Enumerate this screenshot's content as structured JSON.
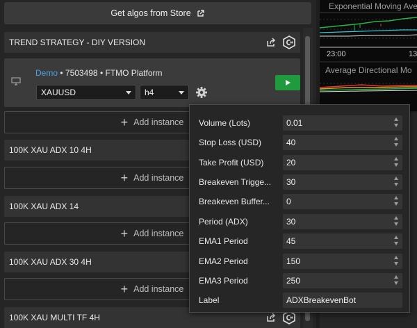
{
  "store_button": {
    "label": "Get algos from Store"
  },
  "strategies": [
    {
      "name": "TREND STRATEGY - DIY VERSION"
    },
    {
      "name": "100K XAU ADX 10 4H"
    },
    {
      "name": "100K XAU ADX 14"
    },
    {
      "name": "100K XAU ADX 30 4H"
    },
    {
      "name": "100K XAU MULTI TF 4H"
    }
  ],
  "instance": {
    "account_type": "Demo",
    "bullet1": " • ",
    "account_number": "7503498",
    "bullet2": " •  ",
    "platform": "FTMO Platform",
    "symbol": "XAUUSD",
    "timeframe": "h4"
  },
  "add_instance_label": "Add instance",
  "chart": {
    "indicator1": "Exponential Moving Ave",
    "indicator2": "Average Directional Mo",
    "time_left": "23:00",
    "time_right": "13"
  },
  "parameters": [
    {
      "label": "Volume (Lots)",
      "value": "0.01",
      "spinner": true
    },
    {
      "label": "Stop Loss (USD)",
      "value": "40",
      "spinner": true
    },
    {
      "label": "Take Profit (USD)",
      "value": "20",
      "spinner": true
    },
    {
      "label": "Breakeven Trigge...",
      "value": "30",
      "spinner": true
    },
    {
      "label": "Breakeven Buffer...",
      "value": "0",
      "spinner": true
    },
    {
      "label": "Period (ADX)",
      "value": "30",
      "spinner": true
    },
    {
      "label": "EMA1 Period",
      "value": "45",
      "spinner": true
    },
    {
      "label": "EMA2 Period",
      "value": "150",
      "spinner": true
    },
    {
      "label": "EMA3 Period",
      "value": "250",
      "spinner": true
    },
    {
      "label": "Label",
      "value": "ADXBreakevenBot",
      "spinner": false
    }
  ],
  "colors": {
    "accent_blue": "#4aa3e8",
    "play_green": "#1f9b3e"
  }
}
